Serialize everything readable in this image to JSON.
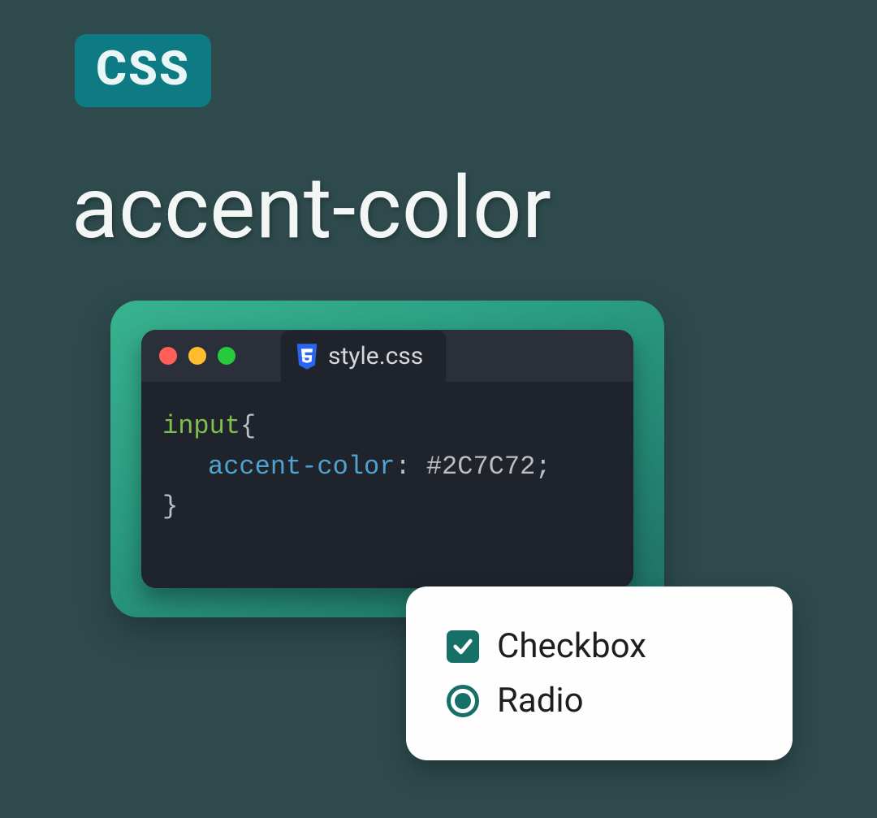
{
  "badge": {
    "label": "CSS"
  },
  "title": "accent-color",
  "editor": {
    "tab_filename": "style.css",
    "code": {
      "selector": "input",
      "property": "accent-color",
      "value": "#2C7C72"
    }
  },
  "panel": {
    "checkbox_label": "Checkbox",
    "radio_label": "Radio"
  },
  "colors": {
    "accent": "#2C7C72"
  }
}
